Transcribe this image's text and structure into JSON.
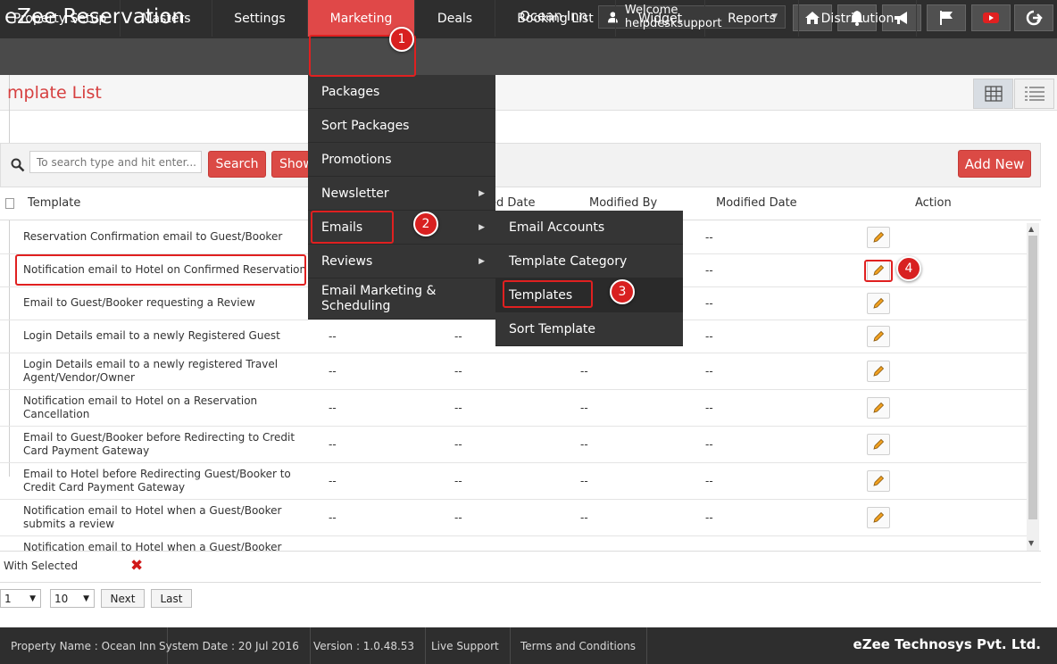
{
  "app": {
    "title": "eZee Reservation",
    "property": "Ocean Inn",
    "welcome": "Welcome helpdesksupport"
  },
  "top_icons": [
    "home-icon",
    "bell-icon",
    "megaphone-icon",
    "flag-icon",
    "youtube-icon",
    "logout-icon"
  ],
  "colors": {
    "accent": "#db4a45",
    "topbar": "#2e2e2e",
    "nav": "#4a4a4a",
    "menu": "#353535"
  },
  "nav": {
    "items": [
      "Property Setup",
      "Masters",
      "Settings",
      "Marketing",
      "Deals",
      "Booking List",
      "Widget",
      "Reports",
      "Distribution"
    ],
    "active": "Marketing"
  },
  "marketing_menu": {
    "items": [
      "Packages",
      "Sort Packages",
      "Promotions",
      "Newsletter",
      "Emails",
      "Reviews",
      "Email Marketing & Scheduling"
    ]
  },
  "emails_submenu": {
    "items": [
      "Email Accounts",
      "Template Category",
      "Templates",
      "Sort Template"
    ]
  },
  "page": {
    "title": "mplate List",
    "search_placeholder": "To search type and hit enter...",
    "search_button": "Search",
    "show_button": "Show",
    "add_new_button": "Add New"
  },
  "table": {
    "columns": [
      "Template",
      "ed Date",
      "Modified By",
      "Modified Date",
      "Action"
    ],
    "rows": [
      {
        "name": "Reservation Confirmation email to Guest/Booker",
        "cols": [
          "",
          "",
          "",
          "--"
        ]
      },
      {
        "name": "Notification email to Hotel on Confirmed Reservation",
        "cols": [
          "",
          "",
          "",
          "--"
        ]
      },
      {
        "name": "Email to Guest/Booker requesting a Review",
        "cols": [
          "",
          "",
          "",
          "--"
        ]
      },
      {
        "name": "Login Details email to a newly Registered Guest",
        "cols": [
          "--",
          "--",
          "",
          "--"
        ]
      },
      {
        "name": "Login Details email to a newly registered Travel Agent/Vendor/Owner",
        "cols": [
          "--",
          "--",
          "--",
          "--"
        ]
      },
      {
        "name": "Notification email to Hotel on a Reservation Cancellation",
        "cols": [
          "--",
          "--",
          "--",
          "--"
        ]
      },
      {
        "name": "Email to Guest/Booker before Redirecting to Credit Card Payment Gateway",
        "cols": [
          "--",
          "--",
          "--",
          "--"
        ]
      },
      {
        "name": "Email to Hotel before Redirecting Guest/Booker to Credit Card Payment Gateway",
        "cols": [
          "--",
          "--",
          "--",
          "--"
        ]
      },
      {
        "name": "Notification email to Hotel when a Guest/Booker submits a review",
        "cols": [
          "--",
          "--",
          "--",
          "--"
        ]
      },
      {
        "name": "Notification email to Hotel when a Guest/Booker sends",
        "cols": [
          "",
          "",
          "",
          ""
        ]
      }
    ]
  },
  "bulk": {
    "with_selected": "With Selected",
    "delete_symbol": "✖"
  },
  "pager": {
    "page": "1",
    "per_page": "10",
    "next": "Next",
    "last": "Last"
  },
  "footer": {
    "property": "Property Name : Ocean Inn",
    "system_date": "System Date : 20 Jul 2016",
    "version": "Version : 1.0.48.53",
    "live_support": "Live Support",
    "terms": "Terms and Conditions",
    "company": "eZee Technosys Pvt. Ltd."
  },
  "annotations": [
    "1",
    "2",
    "3",
    "4"
  ]
}
